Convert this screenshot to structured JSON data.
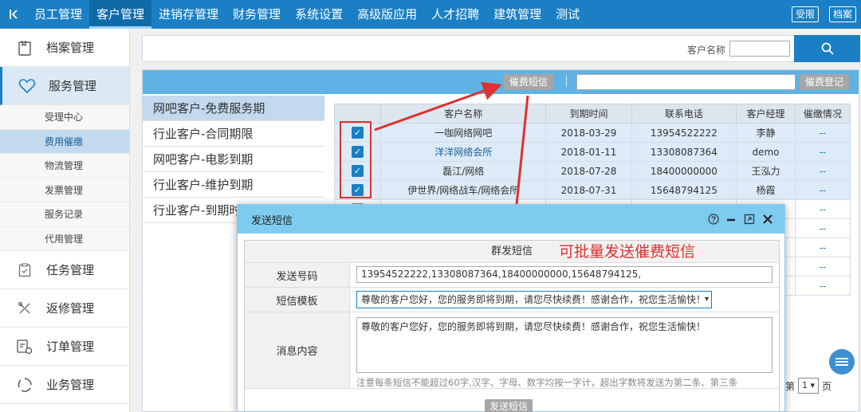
{
  "topnav": {
    "back_icon": "back-chevron-icon",
    "items": [
      {
        "label": "员工管理"
      },
      {
        "label": "客户管理"
      },
      {
        "label": "进销存管理"
      },
      {
        "label": "财务管理"
      },
      {
        "label": "系统设置"
      },
      {
        "label": "高级版应用"
      },
      {
        "label": "人才招聘"
      },
      {
        "label": "建筑管理"
      },
      {
        "label": "测试"
      }
    ],
    "active": "客户管理",
    "right_buttons": [
      "受限",
      "档案"
    ]
  },
  "sidebar": {
    "items": [
      {
        "label": "档案管理",
        "icon": "folder-icon"
      },
      {
        "label": "服务管理",
        "icon": "heart-icon"
      },
      {
        "label": "任务管理",
        "icon": "clipboard-icon"
      },
      {
        "label": "返修管理",
        "icon": "tools-icon"
      },
      {
        "label": "订单管理",
        "icon": "order-icon"
      },
      {
        "label": "业务管理",
        "icon": "spinner-icon"
      }
    ],
    "sub_items": [
      {
        "label": "受理中心"
      },
      {
        "label": "费用催缴"
      },
      {
        "label": "物流管理"
      },
      {
        "label": "发票管理"
      },
      {
        "label": "服务记录"
      },
      {
        "label": "代用管理"
      }
    ],
    "active_item": "服务管理",
    "active_sub": "费用催缴"
  },
  "search": {
    "label": "客户名称",
    "value": "",
    "button_icon": "search-icon"
  },
  "toolbar": {
    "sms_button": "催费短信",
    "register_button": "催费登记",
    "input_value": ""
  },
  "categories": [
    {
      "label": "网吧客户-免费服务期"
    },
    {
      "label": "行业客户-合同期限"
    },
    {
      "label": "网吧客户-电影到期"
    },
    {
      "label": "行业客户-维护到期"
    },
    {
      "label": "行业客户-到期时"
    }
  ],
  "active_category": "网吧客户-免费服务期",
  "table": {
    "columns": [
      "客户名称",
      "到期时间",
      "联系电话",
      "客户经理",
      "催缴情况"
    ],
    "rows": [
      {
        "checked": true,
        "name": "一咖网络网吧",
        "expire": "2018-03-29",
        "phone": "13954522222",
        "manager": "李静",
        "status": "--"
      },
      {
        "checked": true,
        "name": "洋洋网络会所",
        "expire": "2018-01-11",
        "phone": "13308087364",
        "manager": "demo",
        "status": "--"
      },
      {
        "checked": true,
        "name": "磊江/网络",
        "expire": "2018-07-28",
        "phone": "18400000000",
        "manager": "王泓力",
        "status": "--"
      },
      {
        "checked": true,
        "name": "伊世界/网络战车/网络会所",
        "expire": "2018-07-31",
        "phone": "15648794125",
        "manager": "杨霞",
        "status": "--"
      },
      {
        "checked": false,
        "name": "",
        "expire": "",
        "phone": "",
        "manager": "",
        "status": "--"
      },
      {
        "checked": false,
        "name": "",
        "expire": "",
        "phone": "",
        "manager": "",
        "status": "--"
      },
      {
        "checked": false,
        "name": "",
        "expire": "",
        "phone": "",
        "manager": "",
        "status": "--"
      },
      {
        "checked": false,
        "name": "",
        "expire": "",
        "phone": "",
        "manager": "",
        "status": "--"
      },
      {
        "checked": false,
        "name": "",
        "expire": "",
        "phone": "",
        "manager": "",
        "status": "--"
      }
    ]
  },
  "pager": {
    "prefix": "第",
    "page": "1",
    "suffix": "页"
  },
  "dialog": {
    "title": "发送短信",
    "section_title": "群发短信",
    "annotation": "可批量发送催费短信",
    "controls": [
      "help-icon",
      "minimize-icon",
      "maximize-icon",
      "close-icon"
    ],
    "fields": {
      "numbers_label": "发送号码",
      "numbers_value": "13954522222,13308087364,18400000000,15648794125,",
      "template_label": "短信模板",
      "template_value": "尊敬的客户您好，您的服务即将到期，请您尽快续费！感谢合作，祝您生活愉快！",
      "content_label": "消息内容",
      "content_value": "尊敬的客户您好，您的服务即将到期，请您尽快续费！感谢合作，祝您生活愉快！",
      "hint": "注意每条短信不能超过60字,汉字、字母、数字均按一字计，超出字数将发送为第二条、第三条"
    },
    "send_button": "发送短信"
  },
  "colors": {
    "primary": "#1a7fc4",
    "toolbar": "#5fb2e3",
    "dialog_header": "#7ecbf0",
    "annotation": "#e03030",
    "grey_button": "#a6a6a6"
  }
}
